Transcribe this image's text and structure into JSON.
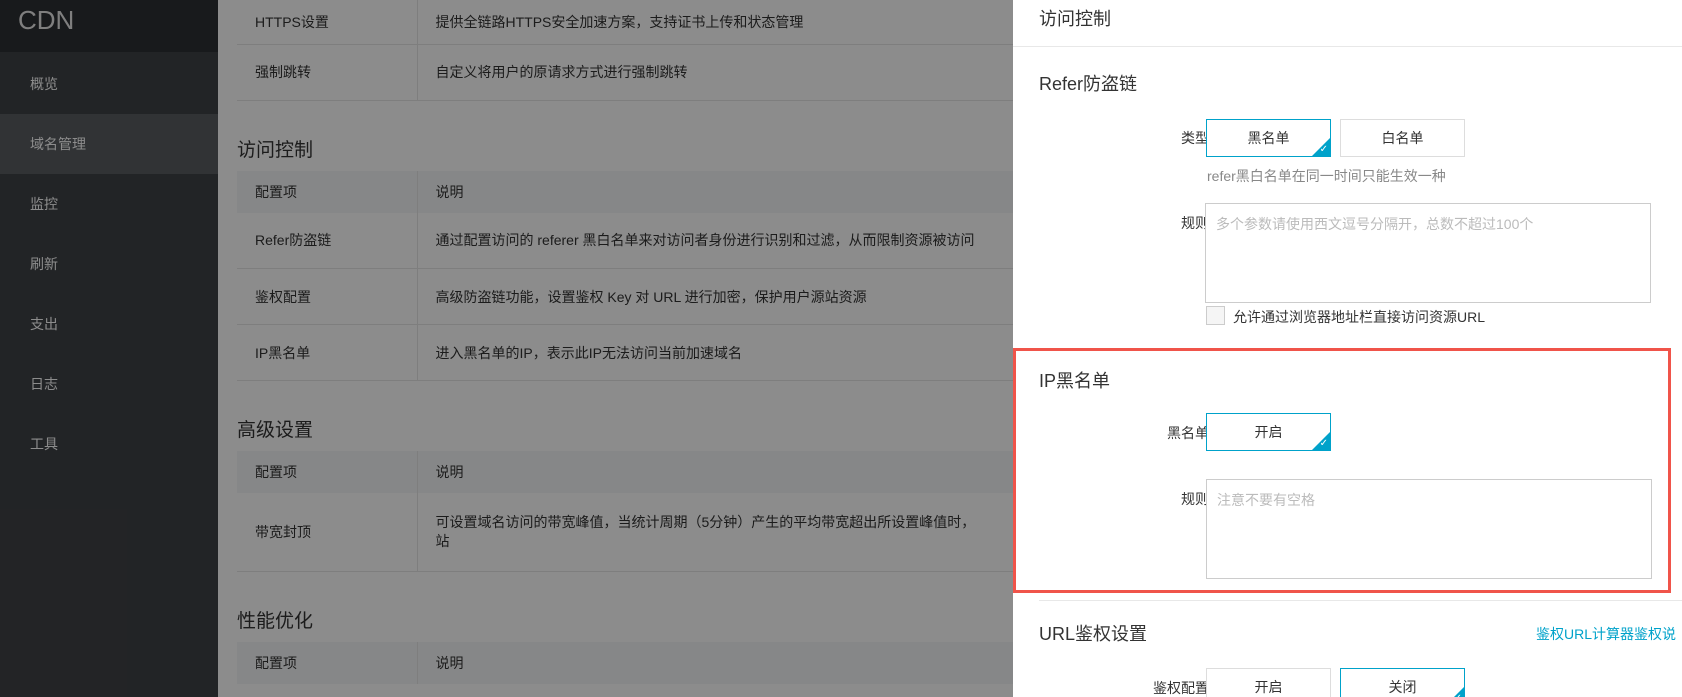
{
  "sidebar": {
    "brand": "CDN",
    "items": [
      {
        "label": "概览"
      },
      {
        "label": "域名管理"
      },
      {
        "label": "监控"
      },
      {
        "label": "刷新"
      },
      {
        "label": "支出"
      },
      {
        "label": "日志"
      },
      {
        "label": "工具"
      }
    ]
  },
  "main": {
    "top_rows": [
      {
        "name": "HTTPS设置",
        "desc": "提供全链路HTTPS安全加速方案，支持证书上传和状态管理"
      },
      {
        "name": "强制跳转",
        "desc": "自定义将用户的原请求方式进行强制跳转"
      }
    ],
    "access_section": {
      "title": "访问控制",
      "header": {
        "name": "配置项",
        "desc": "说明"
      },
      "rows": [
        {
          "name": "Refer防盗链",
          "desc": "通过配置访问的 referer 黑白名单来对访问者身份进行识别和过滤，从而限制资源被访问"
        },
        {
          "name": "鉴权配置",
          "desc": "高级防盗链功能，设置鉴权 Key 对 URL 进行加密，保护用户源站资源"
        },
        {
          "name": "IP黑名单",
          "desc": "进入黑名单的IP，表示此IP无法访问当前加速域名"
        }
      ]
    },
    "advanced_section": {
      "title": "高级设置",
      "header": {
        "name": "配置项",
        "desc": "说明"
      },
      "rows": [
        {
          "name": "带宽封顶",
          "desc": "可设置域名访问的带宽峰值，当统计周期（5分钟）产生的平均带宽超出所设置峰值时，\n站"
        }
      ]
    },
    "perf_section": {
      "title": "性能优化",
      "header": {
        "name": "配置项",
        "desc": "说明"
      }
    }
  },
  "panel": {
    "title": "访问控制",
    "refer": {
      "title": "Refer防盗链",
      "type_label": "类型",
      "blacklist_btn": "黑名单",
      "whitelist_btn": "白名单",
      "hint": "refer黑白名单在同一时间只能生效一种",
      "rule_label": "规则",
      "rule_placeholder": "多个参数请使用西文逗号分隔开，总数不超过100个",
      "allow_checkbox_label": "允许通过浏览器地址栏直接访问资源URL",
      "allow_checked": false
    },
    "ip_blacklist": {
      "title": "IP黑名单",
      "blacklist_label": "黑名单",
      "on_btn": "开启",
      "rule_label": "规则",
      "rule_placeholder": "注意不要有空格"
    },
    "url_auth": {
      "title": "URL鉴权设置",
      "link": "鉴权URL计算器鉴权说",
      "config_label": "鉴权配置",
      "on_btn": "开启",
      "off_btn": "关闭"
    }
  },
  "colors": {
    "accent": "#00a2ca",
    "highlight": "#f0544a",
    "sidebar_bg": "#3f4246"
  }
}
